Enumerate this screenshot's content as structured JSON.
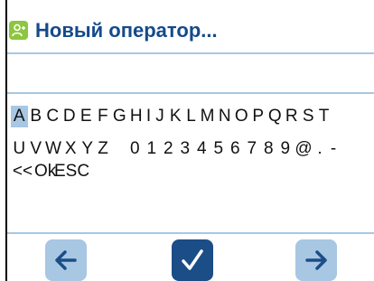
{
  "header": {
    "title": "Новый оператор...",
    "app_icon": "user-add-icon"
  },
  "keyboard": {
    "selected_key": "A",
    "rows": [
      [
        "A",
        "B",
        "C",
        "D",
        "E",
        "F",
        "G",
        "H",
        "I",
        "J",
        "K",
        "L",
        "M",
        "N",
        "O",
        "P",
        "Q",
        "R",
        "S",
        "T"
      ],
      [
        "U",
        "V",
        "W",
        "X",
        "Y",
        "Z",
        " ",
        "0",
        "1",
        "2",
        "3",
        "4",
        "5",
        "6",
        "7",
        "8",
        "9",
        "@",
        ".",
        "-"
      ],
      [
        "<<",
        "Ok",
        "ESC"
      ]
    ]
  },
  "footer": {
    "prev_icon": "arrow-left-icon",
    "ok_icon": "checkmark-icon",
    "next_icon": "arrow-right-icon"
  },
  "colors": {
    "accent_light": "#a7c7e3",
    "accent_dark": "#1b4d87",
    "title": "#154a8a",
    "icon_green": "#8dc63f"
  }
}
